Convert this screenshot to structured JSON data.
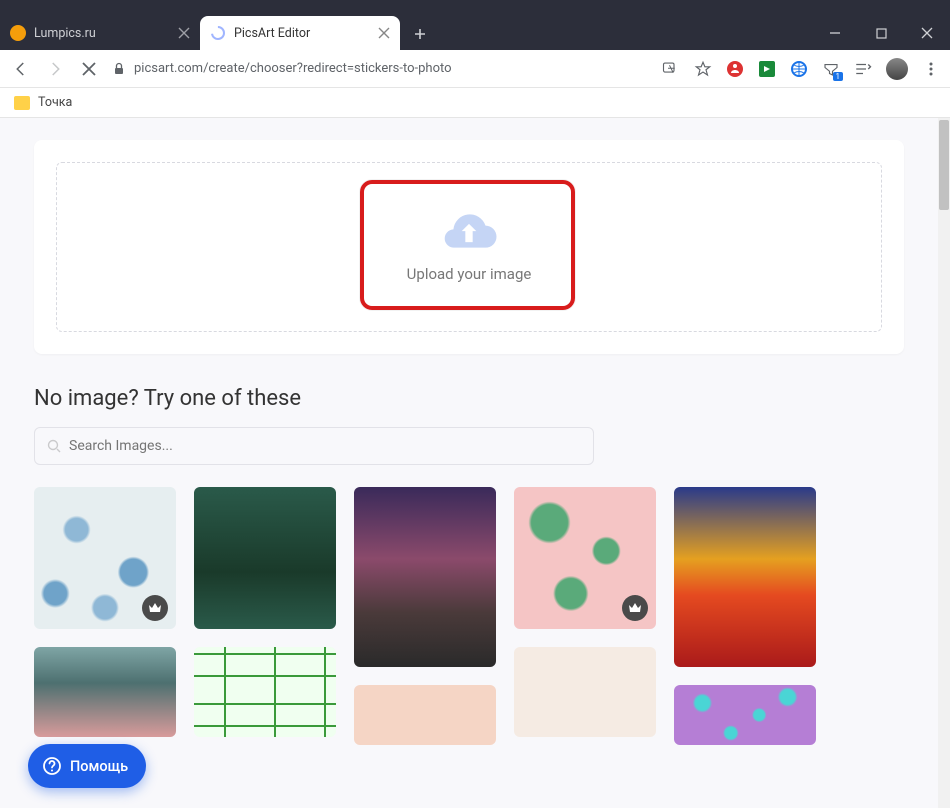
{
  "tabs": [
    {
      "title": "Lumpics.ru",
      "active": false,
      "favicon_color": "#f59e0b"
    },
    {
      "title": "PicsArt Editor",
      "active": true,
      "favicon_color": "#a0b5ff"
    }
  ],
  "url": "picsart.com/create/chooser?redirect=stickers-to-photo",
  "bookmark": {
    "label": "Точка"
  },
  "upload": {
    "label": "Upload your image"
  },
  "section": {
    "heading": "No image? Try one of these"
  },
  "search": {
    "placeholder": "Search Images..."
  },
  "help": {
    "label": "Помощь"
  }
}
